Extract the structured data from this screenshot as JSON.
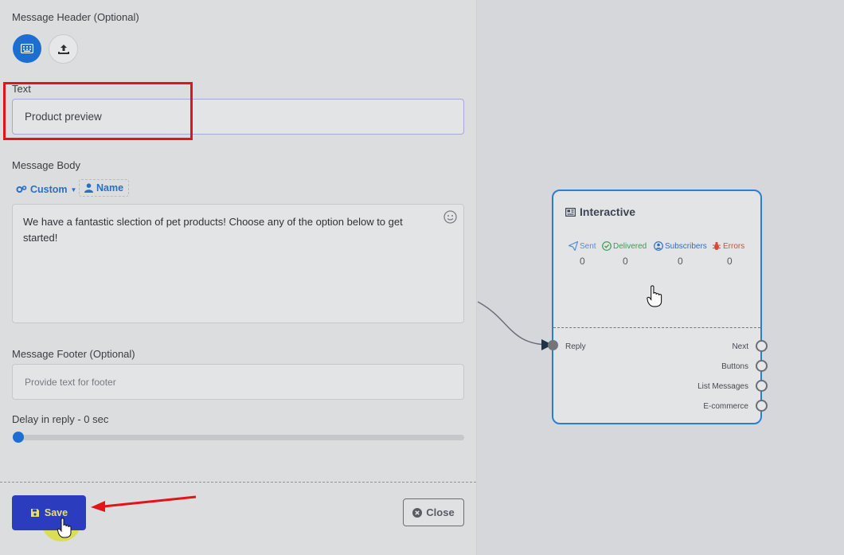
{
  "panel": {
    "header_label": "Message Header (Optional)",
    "header_options": [
      {
        "icon": "keyboard-icon",
        "selected": true
      },
      {
        "icon": "upload-icon",
        "selected": false
      }
    ],
    "text_label": "Text",
    "text_value": "Product preview",
    "body_label": "Message Body",
    "body_chips": {
      "custom": "Custom",
      "name": "Name"
    },
    "body_text": "We have a fantastic slection of pet products! Choose any of the option below to  get started!",
    "footer_label": "Message Footer (Optional)",
    "footer_placeholder": "Provide text for footer",
    "delay_label": "Delay in reply  -  0 sec",
    "delay_value": 0,
    "save_label": "Save",
    "close_label": "Close"
  },
  "node": {
    "title": "Interactive",
    "stats": [
      {
        "label": "Sent",
        "value": "0",
        "color": "#4f8fd6"
      },
      {
        "label": "Delivered",
        "value": "0",
        "color": "#3a9e4e"
      },
      {
        "label": "Subscribers",
        "value": "0",
        "color": "#2f6fc0"
      },
      {
        "label": "Errors",
        "value": "0",
        "color": "#d44a3c"
      }
    ],
    "input_port": "Reply",
    "output_ports": [
      "Next",
      "Buttons",
      "List Messages",
      "E-commerce"
    ]
  },
  "colors": {
    "accent": "#1c6fd0",
    "save_bg": "#2b3cbf",
    "highlight": "#e3131a",
    "node_border": "#2b7fd3"
  }
}
